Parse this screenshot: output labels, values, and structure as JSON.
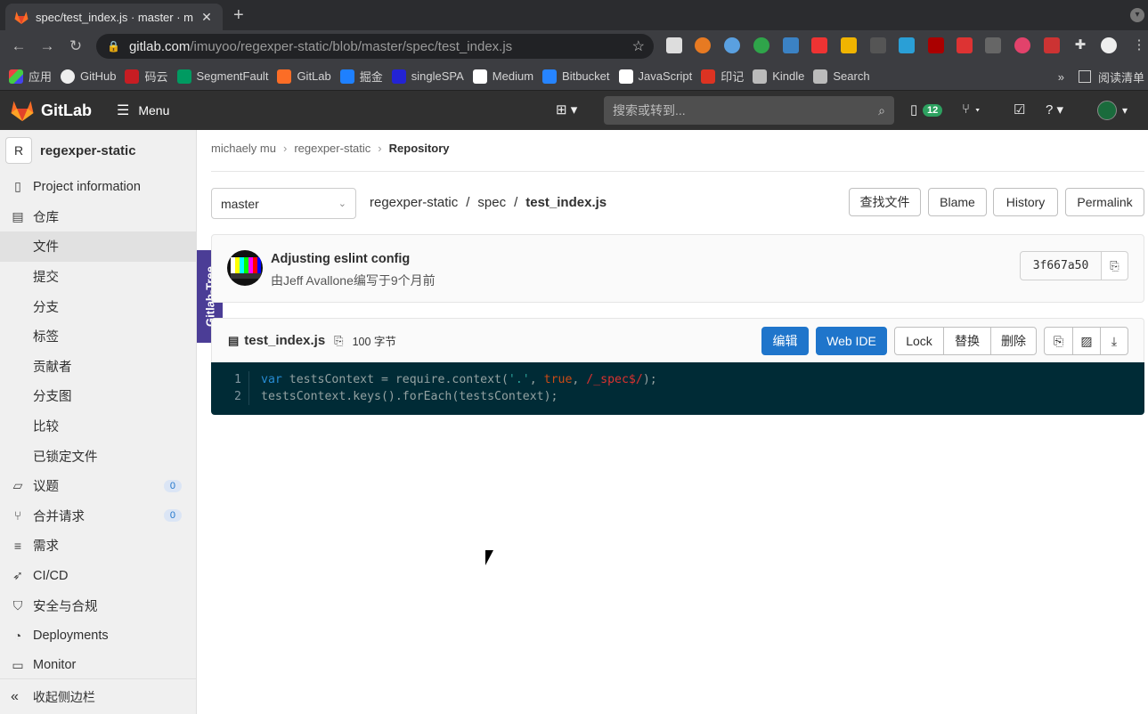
{
  "browser": {
    "tab_title": "spec/test_index.js · master · m",
    "tab_close": "✕",
    "new_tab": "+",
    "url_host": "gitlab.com",
    "url_path": "/imuyoo/regexper-static/blob/master/spec/test_index.js",
    "bookmarks": [
      "应用",
      "GitHub",
      "码云",
      "SegmentFault",
      "GitLab",
      "掘金",
      "singleSPA",
      "Medium",
      "Bitbucket",
      "JavaScript",
      "印记",
      "Kindle",
      "Search"
    ],
    "bookmarks_more": "»",
    "reading_list": "阅读清单"
  },
  "gitlab_nav": {
    "logo": "GitLab",
    "menu": "Menu",
    "search_placeholder": "搜索或转到...",
    "issues_count": "12"
  },
  "sidebar": {
    "project_avatar": "R",
    "project_name": "regexper-static",
    "items": [
      {
        "label": "Project information",
        "icon": "info-icon"
      },
      {
        "label": "仓库",
        "icon": "doc-icon"
      },
      {
        "label": "文件",
        "sub": true,
        "active": true
      },
      {
        "label": "提交",
        "sub": true
      },
      {
        "label": "分支",
        "sub": true
      },
      {
        "label": "标签",
        "sub": true
      },
      {
        "label": "贡献者",
        "sub": true
      },
      {
        "label": "分支图",
        "sub": true
      },
      {
        "label": "比较",
        "sub": true
      },
      {
        "label": "已锁定文件",
        "sub": true
      },
      {
        "label": "议题",
        "icon": "issues-icon",
        "count": "0"
      },
      {
        "label": "合并请求",
        "icon": "merge-request-icon",
        "count": "0"
      },
      {
        "label": "需求",
        "icon": "requirements-icon"
      },
      {
        "label": "CI/CD",
        "icon": "rocket-icon"
      },
      {
        "label": "安全与合规",
        "icon": "shield-icon"
      },
      {
        "label": "Deployments",
        "icon": "deployments-icon"
      },
      {
        "label": "Monitor",
        "icon": "monitor-icon"
      }
    ],
    "collapse_label": "收起侧边栏",
    "gitlab_tree": "Gitlab-Tree"
  },
  "breadcrumb": {
    "items": [
      "michaely mu",
      "regexper-static",
      "Repository"
    ]
  },
  "file_nav": {
    "branch": "master",
    "path": [
      "regexper-static",
      "spec",
      "test_index.js"
    ],
    "buttons": {
      "find": "查找文件",
      "blame": "Blame",
      "history": "History",
      "permalink": "Permalink"
    }
  },
  "commit": {
    "title": "Adjusting eslint config",
    "meta": "由Jeff Avallone编写于9个月前",
    "sha": "3f667a50"
  },
  "file": {
    "name": "test_index.js",
    "size": "100 字节",
    "buttons": {
      "edit": "编辑",
      "webide": "Web IDE",
      "lock": "Lock",
      "replace": "替换",
      "delete": "删除"
    },
    "lines": [
      {
        "n": "1",
        "code": "var testsContext = require.context('.', true, /_spec$/);"
      },
      {
        "n": "2",
        "code": "testsContext.keys().forEach(testsContext);"
      }
    ]
  },
  "colors": {
    "primary": "#1f75cb",
    "nav_bg": "#303030",
    "code_bg": "#002b36",
    "gitlab_tree": "#4b3d96"
  }
}
